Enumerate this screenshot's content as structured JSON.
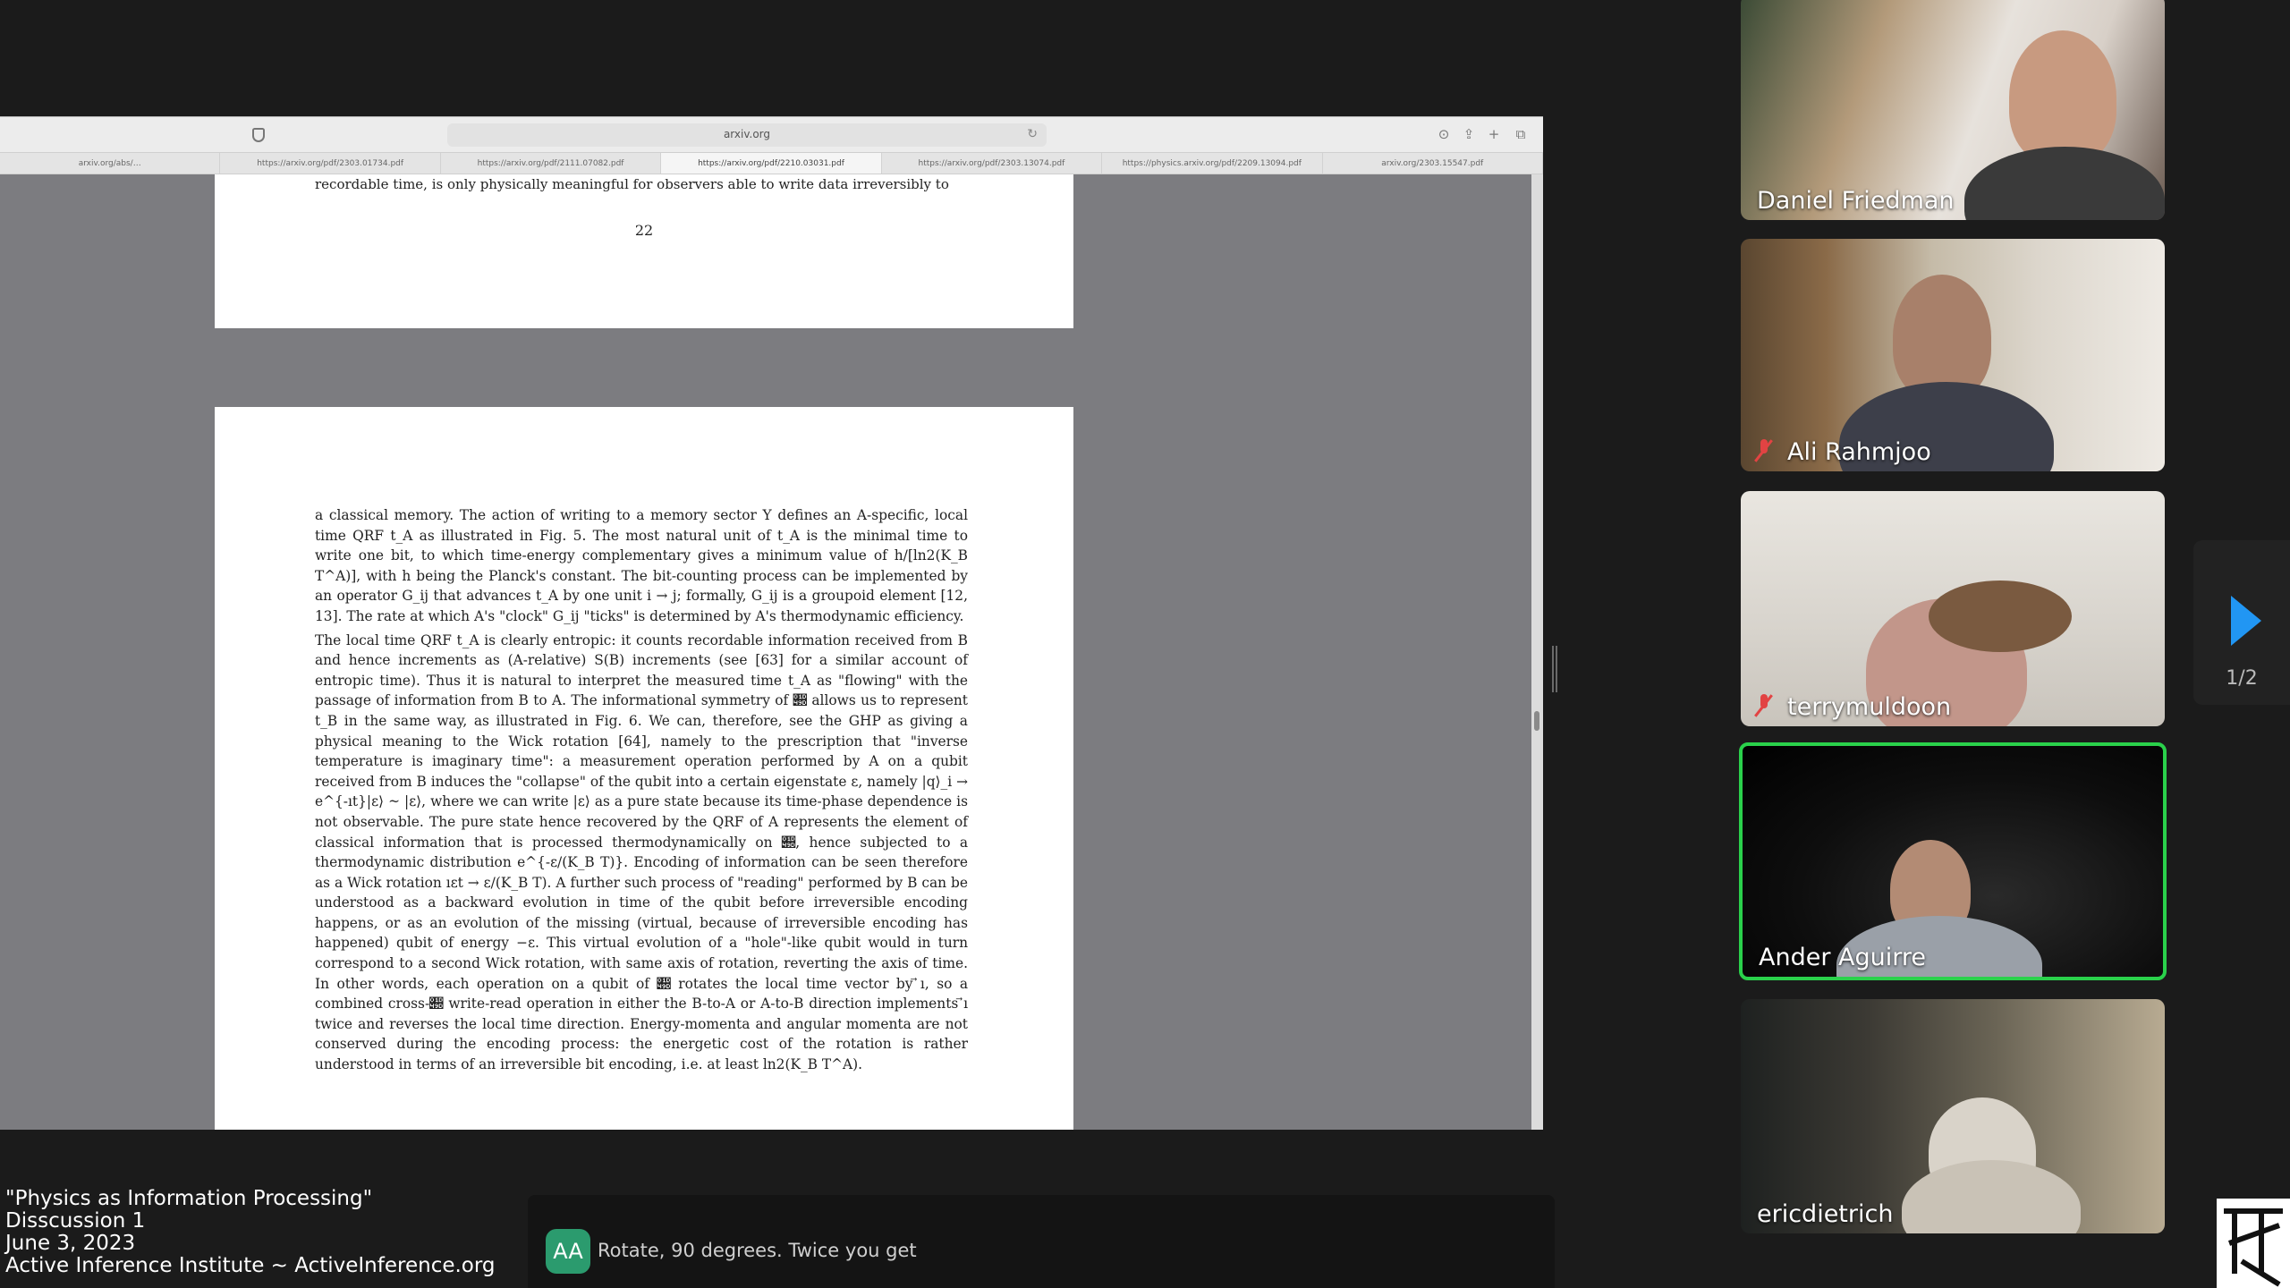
{
  "browser": {
    "url": "arxiv.org",
    "tabs": [
      "arxiv.org/abs/…",
      "https://arxiv.org/pdf/2303.01734.pdf",
      "https://arxiv.org/pdf/2111.07082.pdf",
      "https://arxiv.org/pdf/2210.03031.pdf",
      "https://arxiv.org/pdf/2303.13074.pdf",
      "https://physics.arxiv.org/pdf/2209.13094.pdf",
      "arxiv.org/2303.15547.pdf"
    ],
    "active_tab_index": 3
  },
  "document": {
    "page1_last_line": "recordable time, is only physically meaningful for observers able to write data irreversibly to",
    "page_number": "22",
    "paragraphs": [
      "a classical memory. The action of writing to a memory sector Y defines an A-specific, local time QRF t_A as illustrated in Fig. 5. The most natural unit of t_A is the minimal time to write one bit, to which time-energy complementary gives a minimum value of h/[ln2(K_B T^A)], with h being the Planck's constant. The bit-counting process can be implemented by an operator G_ij that advances t_A by one unit i → j; formally, G_ij is a groupoid element [12, 13]. The rate at which A's \"clock\" G_ij \"ticks\" is determined by A's thermodynamic efficiency.",
      "The local time QRF t_A is clearly entropic: it counts recordable information received from B and hence increments as (A-relative) S(B) increments (see [63] for a similar account of entropic time). Thus it is natural to interpret the measured time t_A as \"flowing\" with the passage of information from B to A. The informational symmetry of 𝒝 allows us to represent t_B in the same way, as illustrated in Fig. 6. We can, therefore, see the GHP as giving a physical meaning to the Wick rotation [64], namely to the prescription that \"inverse temperature is imaginary time\": a measurement operation performed by A on a qubit received from B induces the \"collapse\" of the qubit into a certain eigenstate ε, namely |q⟩_i → e^{-ıt}|ε⟩ ~ |ε⟩, where we can write |ε⟩ as a pure state because its time-phase dependence is not observable. The pure state hence recovered by the QRF of A represents the element of classical information that is processed thermodynamically on 𝒝, hence subjected to a thermodynamic distribution e^{-ε/(K_B T)}. Encoding of information can be seen therefore as a Wick rotation ıεt → ε/(K_B T). A further such process of \"reading\" performed by B can be understood as a backward evolution in time of the qubit before irreversible encoding happens, or as an evolution of the missing (virtual, because of irreversible encoding has happened) qubit of energy −ε. This virtual evolution of a \"hole\"-like qubit would in turn correspond to a second Wick rotation, with same axis of rotation, reverting the axis of time. In other words, each operation on a qubit of 𝒝 rotates the local time vector by ⃗ı, so a combined cross-𝒝 write-read operation in either the B-to-A or A-to-B direction implements ⃗ı twice and reverses the local time direction. Energy-momenta and angular momenta are not conserved during the encoding process: the energetic cost of the rotation is rather understood in terms of an irreversible bit encoding, i.e. at least ln2(K_B T^A)."
    ]
  },
  "participants": [
    {
      "name": "Daniel Friedman",
      "muted": false,
      "active": false
    },
    {
      "name": "Ali Rahmjoo",
      "muted": true,
      "active": false
    },
    {
      "name": "terrymuldoon",
      "muted": true,
      "active": false
    },
    {
      "name": "Ander Aguirre",
      "muted": false,
      "active": true
    },
    {
      "name": "ericdietrich",
      "muted": false,
      "active": false
    }
  ],
  "pager": {
    "label": "1/2"
  },
  "chat": {
    "initials": "AA",
    "message": "Rotate, 90 degrees. Twice you get"
  },
  "caption": {
    "line1": "\"Physics as Information Processing\"",
    "line2": "Disscussion 1",
    "line3": "June 3, 2023",
    "line4": "Active Inference Institute ~ ActiveInference.org"
  },
  "colors": {
    "active_speaker_border": "#2ad14b",
    "pager_arrow": "#2196f3",
    "mute_icon": "#e24343",
    "chat_avatar": "#2b9b6e"
  },
  "icons": [
    "shield-icon",
    "reload-icon",
    "download-icon",
    "share-icon",
    "new-tab-icon",
    "tab-overview-icon",
    "mic-muted-icon",
    "next-page-arrow-icon",
    "institute-logo"
  ]
}
